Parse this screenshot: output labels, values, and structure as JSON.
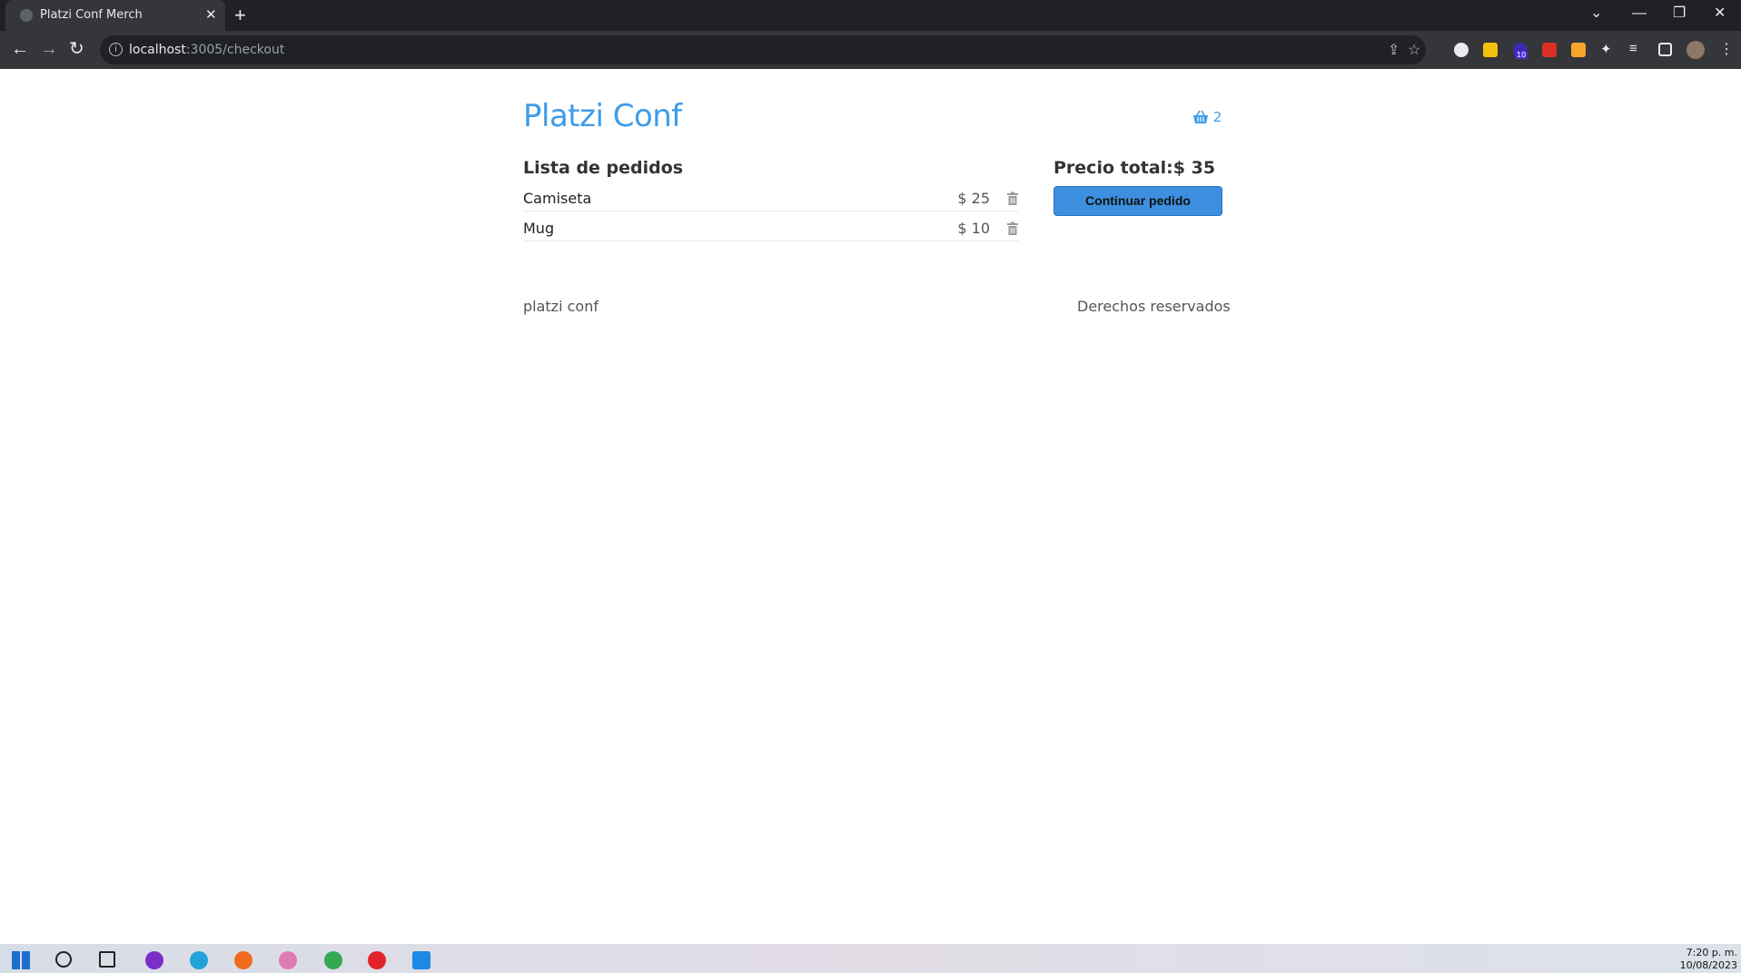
{
  "browser": {
    "tab_title": "Platzi Conf Merch",
    "url_host": "localhost",
    "url_path": ":3005/checkout",
    "extension_badge": "10"
  },
  "header": {
    "title": "Platzi Conf",
    "cart_count": "2"
  },
  "orders": {
    "heading": "Lista de pedidos",
    "items": [
      {
        "name": "Camiseta",
        "price": "$ 25"
      },
      {
        "name": "Mug",
        "price": "$ 10"
      }
    ]
  },
  "summary": {
    "total_label": "Precio total:$ 35",
    "continue_label": "Continuar pedido"
  },
  "footer": {
    "left": "platzi conf",
    "right": "Derechos reservados"
  },
  "taskbar": {
    "time": "7:20 p. m.",
    "date": "10/08/2023"
  },
  "colors": {
    "accent": "#3d9cea",
    "button": "#3d8fe0"
  }
}
